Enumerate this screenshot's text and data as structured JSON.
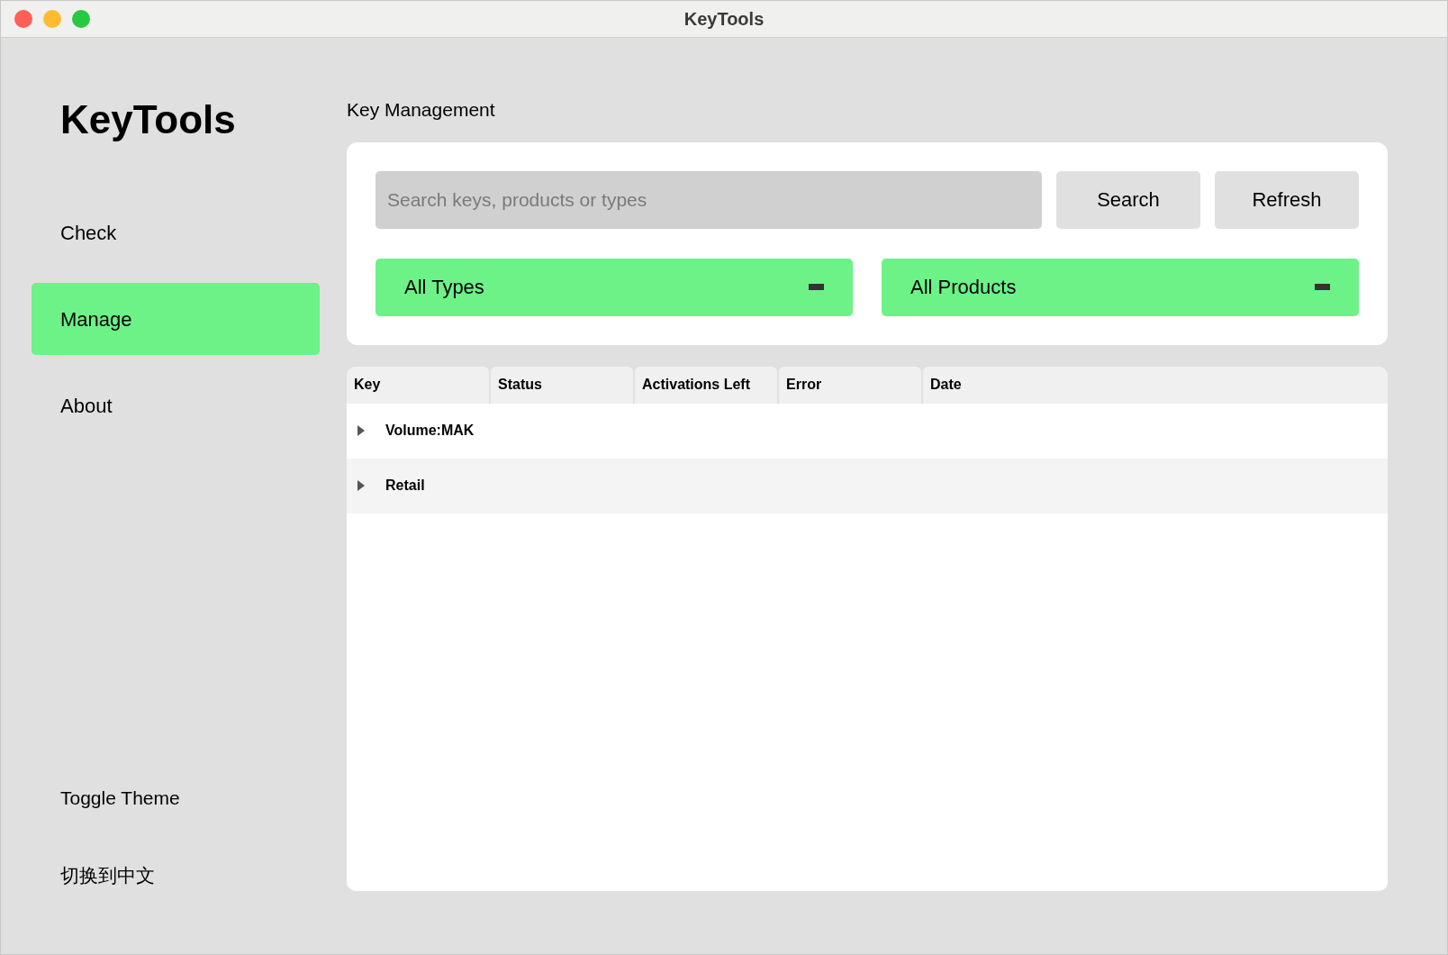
{
  "window": {
    "title": "KeyTools"
  },
  "sidebar": {
    "logo": "KeyTools",
    "items": [
      {
        "label": "Check",
        "selected": false
      },
      {
        "label": "Manage",
        "selected": true
      },
      {
        "label": "About",
        "selected": false
      }
    ],
    "bottom_items": [
      "Toggle Theme",
      "切换到中文"
    ]
  },
  "main": {
    "title": "Key Management",
    "search": {
      "placeholder": "Search keys, products or types"
    },
    "buttons": [
      "Search",
      "Refresh"
    ],
    "dropdowns": [
      {
        "value": "All Types"
      },
      {
        "value": "All Products"
      }
    ],
    "table": {
      "columns": [
        "Key",
        "Status",
        "Activations Left",
        "Error",
        "Date"
      ],
      "rows": [
        {
          "label": "Volume:MAK",
          "expanded": false
        },
        {
          "label": "Retail",
          "expanded": false
        }
      ]
    }
  }
}
